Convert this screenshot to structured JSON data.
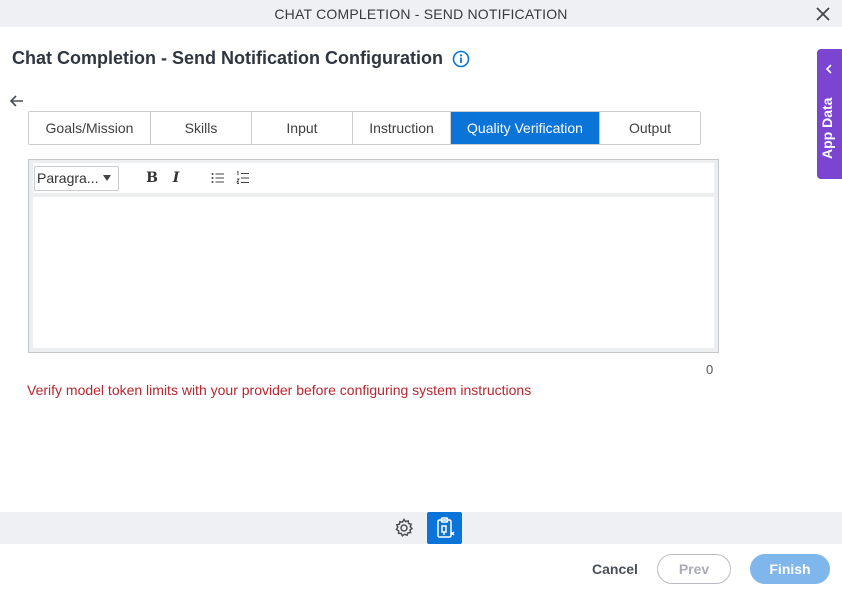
{
  "window": {
    "title": "CHAT COMPLETION - SEND NOTIFICATION"
  },
  "page": {
    "heading": "Chat Completion - Send Notification Configuration"
  },
  "tabs": [
    {
      "label": "Goals/Mission",
      "active": false
    },
    {
      "label": "Skills",
      "active": false
    },
    {
      "label": "Input",
      "active": false
    },
    {
      "label": "Instruction",
      "active": false
    },
    {
      "label": "Quality Verification",
      "active": true
    },
    {
      "label": "Output",
      "active": false
    }
  ],
  "editor": {
    "paragraph_select": "Paragra...",
    "bold_label": "B",
    "italic_label": "I",
    "content": "",
    "char_count": "0"
  },
  "warning": "Verify model token limits with your provider before configuring system instructions",
  "side_panel": {
    "label": "App Data"
  },
  "footer": {
    "cancel": "Cancel",
    "prev": "Prev",
    "finish": "Finish"
  },
  "colors": {
    "accent": "#0a74d8",
    "side_panel": "#7b44d1",
    "warning": "#b8262f",
    "finish_disabled": "#7fb6ec"
  },
  "icons": [
    "close-icon",
    "info-icon",
    "back-arrow-icon",
    "caret-down-icon",
    "bulleted-list-icon",
    "numbered-list-icon",
    "chevron-left-icon",
    "gear-icon",
    "clipboard-icon"
  ]
}
